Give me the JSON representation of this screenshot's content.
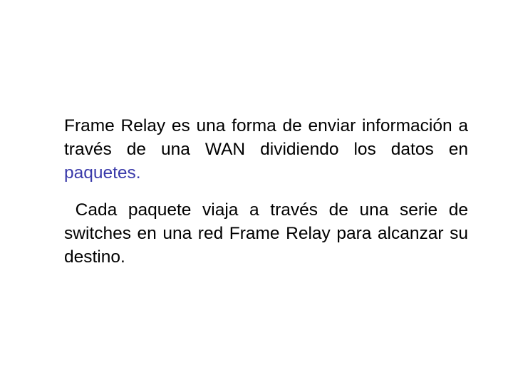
{
  "slide": {
    "paragraphs": [
      {
        "segments": [
          {
            "text": "Frame Relay es una forma de enviar información a través de una WAN dividiendo los datos en ",
            "style": "normal"
          },
          {
            "text": "paquetes.",
            "style": "highlight"
          }
        ]
      },
      {
        "segments": [
          {
            "text": " Cada paquete viaja a través de una serie de switches en una red Frame Relay para alcanzar su destino.",
            "style": "normal"
          }
        ]
      }
    ]
  },
  "colors": {
    "text": "#000000",
    "highlight": "#3a3aaa",
    "background": "#ffffff"
  }
}
